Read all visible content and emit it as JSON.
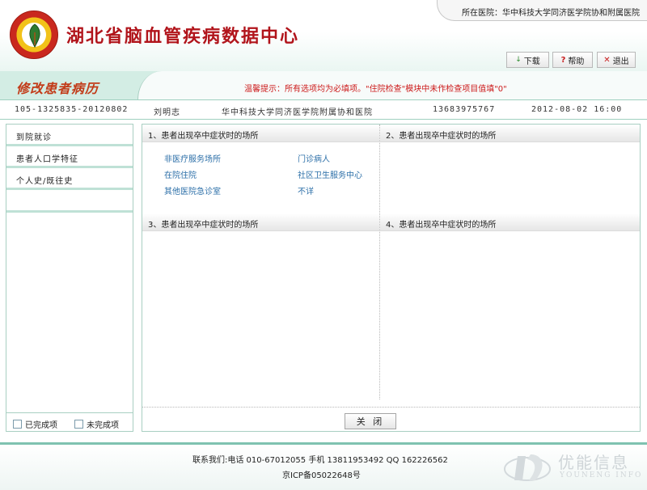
{
  "header": {
    "site_title": "湖北省脑血管疾病数据中心",
    "hospital_label": "所在医院：华中科技大学同济医学院协和附属医院",
    "buttons": {
      "download": "下载",
      "help": "帮助",
      "exit": "退出"
    }
  },
  "titlebar": {
    "page_title": "修改患者病历",
    "tip": "温馨提示：所有选项均为必填项。\"住院检查\"模块中未作检查项目值填\"0\""
  },
  "patient": {
    "record_id": "105-1325835-20120802",
    "name": "刘明志",
    "hospital": "华中科技大学同济医学院附属协和医院",
    "phone": "13683975767",
    "datetime": "2012-08-02 16:00"
  },
  "nav": {
    "items": [
      {
        "label": "到院就诊"
      },
      {
        "label": "患者人口学特征"
      },
      {
        "label": "个人史/既往史"
      }
    ]
  },
  "legend": {
    "completed": "已完成项",
    "incomplete": "未完成项"
  },
  "sections": [
    {
      "title": "1、患者出现卒中症状时的场所"
    },
    {
      "title": "2、患者出现卒中症状时的场所"
    },
    {
      "title": "3、患者出现卒中症状时的场所"
    },
    {
      "title": "4、患者出现卒中症状时的场所"
    }
  ],
  "options": [
    "非医疗服务场所",
    "门诊病人",
    "在院住院",
    "社区卫生服务中心",
    "其他医院急诊室",
    "不详"
  ],
  "close_label": "关 闭",
  "footer": {
    "contact": "联系我们:电话 010-67012055 手机 13811953492 QQ 162226562",
    "icp": "京ICP备05022648号",
    "brand_cn": "优能信息",
    "brand_en": "YOUNENG INFO"
  },
  "colors": {
    "brand_red": "#b1141b",
    "accent_teal": "#7fc2b0",
    "option_blue": "#2c6fa8",
    "tip_red": "#cc1a1a"
  }
}
